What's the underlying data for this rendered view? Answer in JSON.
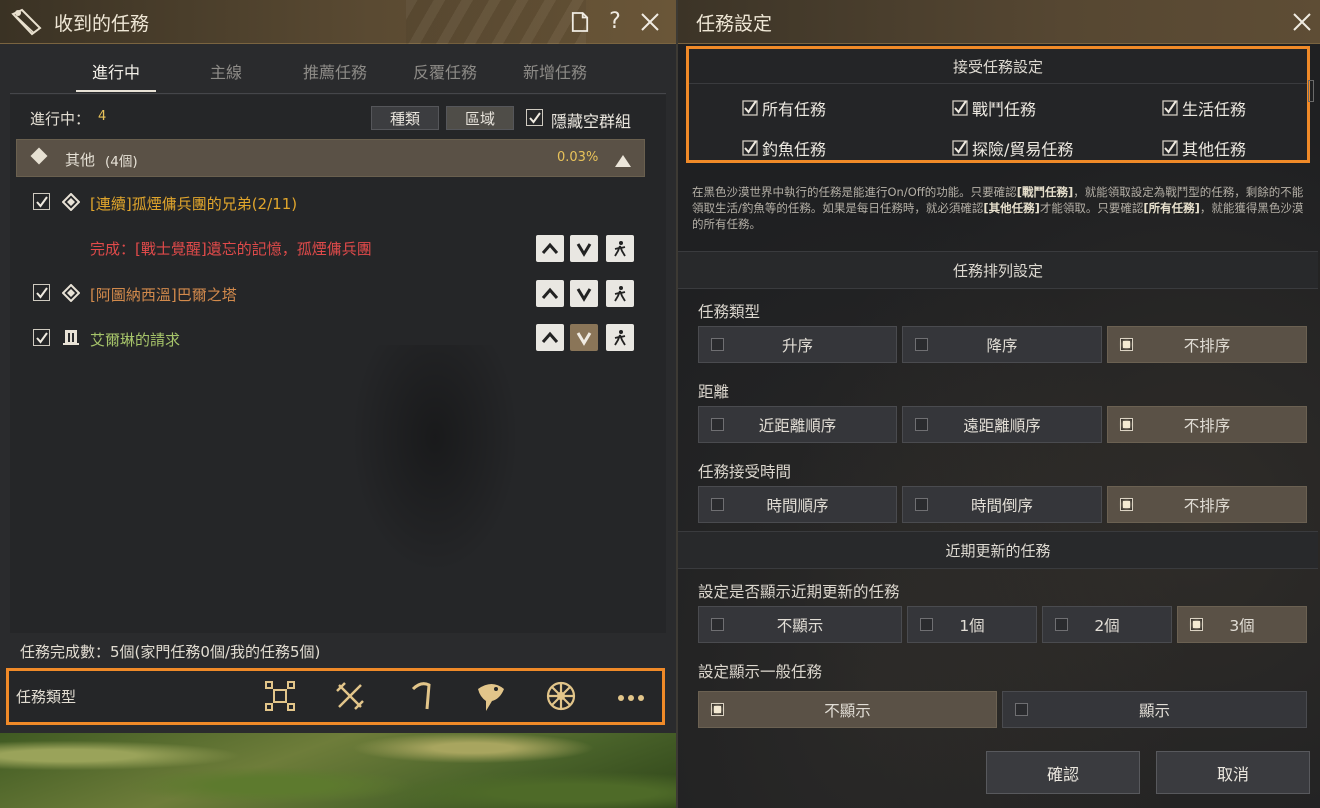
{
  "left": {
    "title": "收到的任務",
    "tabs": [
      {
        "label": "進行中",
        "active": true
      },
      {
        "label": "主線",
        "active": false
      },
      {
        "label": "推薦任務",
        "active": false
      },
      {
        "label": "反覆任務",
        "active": false
      },
      {
        "label": "新增任務",
        "active": false
      }
    ],
    "in_progress_label": "進行中：",
    "in_progress_count": "4",
    "filter_buttons": {
      "type": "種類",
      "region": "區域"
    },
    "hide_empty_label": "隱藏空群組",
    "hide_empty_checked": true,
    "group": {
      "name": "其他",
      "count": "(4個)",
      "percent": "0.03%"
    },
    "quests": [
      {
        "title": "[連續]孤煙傭兵團的兄弟(2/11)",
        "color": "#e0a52c",
        "checked": true,
        "icon": "diamond-quest-icon"
      },
      {
        "subtitle": "完成：[戰士覺醒]遺忘的記憶，孤煙傭兵團",
        "color": "#e04a4a"
      },
      {
        "title": "[阿圖納西溫]巴爾之塔",
        "color": "#d28a4c",
        "checked": true,
        "icon": "diamond-quest-icon"
      },
      {
        "title": "艾爾琳的請求",
        "color": "#a6c46a",
        "checked": true,
        "icon": "scroll-quest-icon"
      }
    ],
    "completion": "任務完成數：5個(家門任務0個/我的任務5個)",
    "type_bar_label": "任務類型",
    "type_icons": [
      "all-types-icon",
      "combat-swords-icon",
      "gathering-pickaxe-icon",
      "fishing-fish-icon",
      "trade-wheel-icon",
      "more-dots-icon"
    ]
  },
  "right": {
    "title": "任務設定",
    "accept_section": {
      "header": "接受任務設定",
      "items": [
        {
          "label": "所有任務",
          "checked": true
        },
        {
          "label": "戰鬥任務",
          "checked": true
        },
        {
          "label": "生活任務",
          "checked": true
        },
        {
          "label": "釣魚任務",
          "checked": true
        },
        {
          "label": "探險/貿易任務",
          "checked": true
        },
        {
          "label": "其他任務",
          "checked": true
        }
      ]
    },
    "description": {
      "part1": "在黑色沙漠世界中執行的任務是能進行On/Off的功能。只要確認",
      "bold1": "[戰鬥任務]",
      "part2": "，就能領取設定為戰鬥型的任務，剩餘的不能領取生活/釣魚等的任務。如果是每日任務時，就必須確認",
      "bold2": "[其他任務]",
      "part3": "才能領取。只要確認",
      "bold3": "[所有任務]",
      "part4": "，就能獲得黑色沙漠的所有任務。"
    },
    "sort_section": {
      "header": "任務排列設定",
      "rows": [
        {
          "label": "任務類型",
          "options": [
            {
              "label": "升序",
              "selected": false
            },
            {
              "label": "降序",
              "selected": false
            },
            {
              "label": "不排序",
              "selected": true
            }
          ]
        },
        {
          "label": "距離",
          "options": [
            {
              "label": "近距離順序",
              "selected": false
            },
            {
              "label": "遠距離順序",
              "selected": false
            },
            {
              "label": "不排序",
              "selected": true
            }
          ]
        },
        {
          "label": "任務接受時間",
          "options": [
            {
              "label": "時間順序",
              "selected": false
            },
            {
              "label": "時間倒序",
              "selected": false
            },
            {
              "label": "不排序",
              "selected": true
            }
          ]
        }
      ]
    },
    "recent_section": {
      "header": "近期更新的任務",
      "show_recent_label": "設定是否顯示近期更新的任務",
      "show_recent_options": [
        {
          "label": "不顯示",
          "selected": false
        },
        {
          "label": "1個",
          "selected": false
        },
        {
          "label": "2個",
          "selected": false
        },
        {
          "label": "3個",
          "selected": true
        }
      ],
      "show_general_label": "設定顯示一般任務",
      "show_general_options": [
        {
          "label": "不顯示",
          "selected": true
        },
        {
          "label": "顯示",
          "selected": false
        }
      ]
    },
    "buttons": {
      "confirm": "確認",
      "cancel": "取消"
    }
  },
  "colors": {
    "accent_orange": "#f08a28",
    "gold_text": "#e8c25a",
    "title_bar": "#564732"
  }
}
